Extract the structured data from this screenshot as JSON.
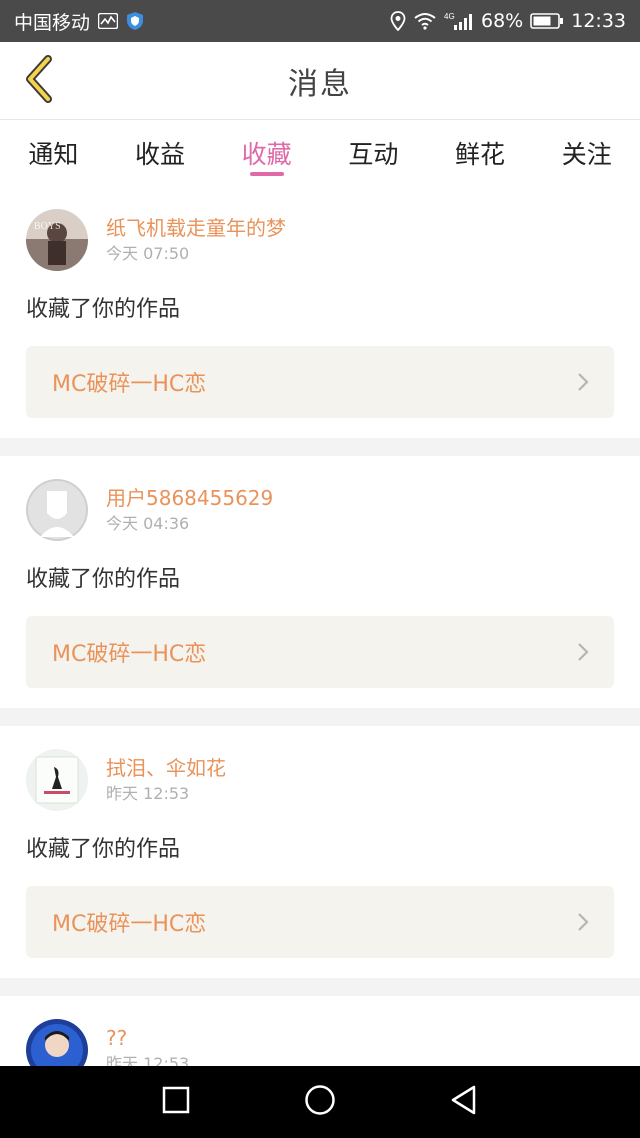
{
  "status_bar": {
    "carrier": "中国移动",
    "network": "4G",
    "battery": "68%",
    "time": "12:33"
  },
  "header": {
    "title": "消息",
    "back_icon": "back-chevron-icon"
  },
  "tabs": [
    {
      "label": "通知",
      "active": false
    },
    {
      "label": "收益",
      "active": false
    },
    {
      "label": "收藏",
      "active": true
    },
    {
      "label": "互动",
      "active": false
    },
    {
      "label": "鲜花",
      "active": false
    },
    {
      "label": "关注",
      "active": false
    }
  ],
  "accent_color": "#e06aa8",
  "name_color": "#e9935b",
  "messages": [
    {
      "user": "纸飞机载走童年的梦",
      "time": "今天 07:50",
      "action": "收藏了你的作品",
      "work_title": "MC破碎一HC恋"
    },
    {
      "user": "用户5868455629",
      "time": "今天 04:36",
      "action": "收藏了你的作品",
      "work_title": "MC破碎一HC恋"
    },
    {
      "user": "拭泪、伞如花",
      "time": "昨天 12:53",
      "action": "收藏了你的作品",
      "work_title": "MC破碎一HC恋"
    },
    {
      "user": "??",
      "time": "昨天 12:53",
      "action": "",
      "work_title": ""
    }
  ],
  "nav": [
    "square-icon",
    "circle-icon",
    "triangle-back-icon"
  ]
}
